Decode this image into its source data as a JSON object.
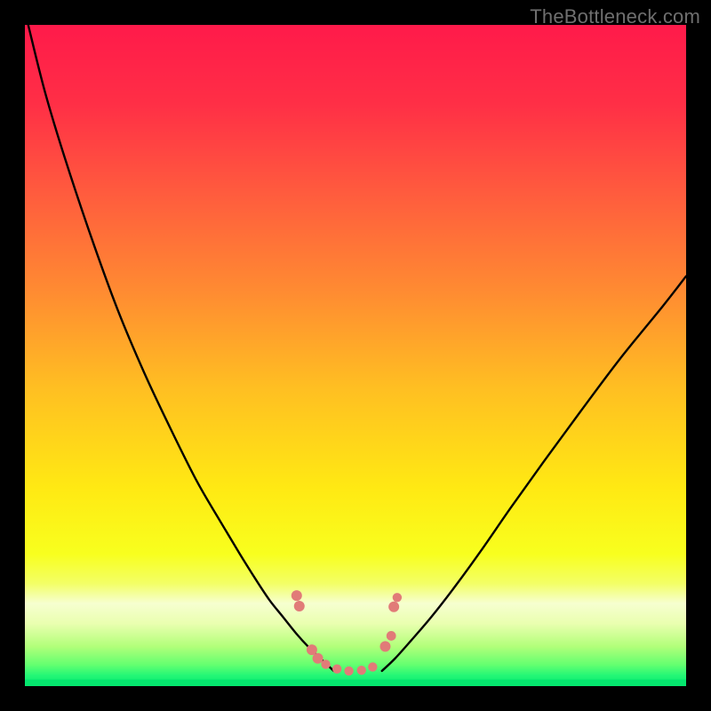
{
  "watermark": "TheBottleneck.com",
  "chart_data": {
    "type": "line",
    "title": "",
    "xlabel": "",
    "ylabel": "",
    "xlim": [
      0,
      100
    ],
    "ylim": [
      0,
      100
    ],
    "series": [
      {
        "name": "left-curve",
        "x": [
          0.5,
          3,
          6,
          10,
          14,
          18,
          22,
          26,
          29.5,
          32.5,
          35,
          37,
          39,
          41,
          43,
          45,
          46.7
        ],
        "y": [
          100,
          90,
          80,
          68,
          57,
          47.5,
          39,
          31,
          25,
          20,
          16,
          13,
          10.5,
          8,
          5.8,
          3.9,
          2.3
        ]
      },
      {
        "name": "right-curve",
        "x": [
          54,
          56,
          58.5,
          61.5,
          65,
          69,
          73.5,
          78.5,
          84,
          90,
          96.5,
          100
        ],
        "y": [
          2.3,
          4.2,
          7,
          10.5,
          15,
          20.5,
          27,
          34,
          41.5,
          49.5,
          57.5,
          62
        ]
      },
      {
        "name": "green-floor",
        "x": [
          0,
          100
        ],
        "y": [
          1.0,
          1.0
        ]
      }
    ],
    "markers": [
      {
        "x": 41.1,
        "y": 13.7,
        "r": 6.0
      },
      {
        "x": 41.5,
        "y": 12.1,
        "r": 6.0
      },
      {
        "x": 43.4,
        "y": 5.5,
        "r": 6.0
      },
      {
        "x": 44.3,
        "y": 4.2,
        "r": 6.0
      },
      {
        "x": 45.5,
        "y": 3.3,
        "r": 5.2
      },
      {
        "x": 47.2,
        "y": 2.6,
        "r": 5.2
      },
      {
        "x": 49.0,
        "y": 2.3,
        "r": 5.2
      },
      {
        "x": 50.9,
        "y": 2.4,
        "r": 5.2
      },
      {
        "x": 52.6,
        "y": 2.9,
        "r": 5.2
      },
      {
        "x": 54.5,
        "y": 6.0,
        "r": 6.0
      },
      {
        "x": 55.4,
        "y": 7.6,
        "r": 5.4
      },
      {
        "x": 55.8,
        "y": 12.0,
        "r": 6.0
      },
      {
        "x": 56.3,
        "y": 13.4,
        "r": 5.2
      }
    ],
    "gradient_stops": [
      {
        "offset": 0.0,
        "color": "#ff1a4a"
      },
      {
        "offset": 0.12,
        "color": "#ff2f46"
      },
      {
        "offset": 0.25,
        "color": "#ff5a3e"
      },
      {
        "offset": 0.4,
        "color": "#ff8a32"
      },
      {
        "offset": 0.55,
        "color": "#ffbf22"
      },
      {
        "offset": 0.7,
        "color": "#ffe913"
      },
      {
        "offset": 0.8,
        "color": "#f8ff1e"
      },
      {
        "offset": 0.845,
        "color": "#f3ff66"
      },
      {
        "offset": 0.875,
        "color": "#f6ffd0"
      },
      {
        "offset": 0.905,
        "color": "#eaffb0"
      },
      {
        "offset": 0.94,
        "color": "#b2ff7a"
      },
      {
        "offset": 0.968,
        "color": "#63ff70"
      },
      {
        "offset": 0.984,
        "color": "#23f776"
      },
      {
        "offset": 1.0,
        "color": "#05e66e"
      }
    ],
    "marker_color": "#e17b78",
    "line_color": "#000000"
  }
}
